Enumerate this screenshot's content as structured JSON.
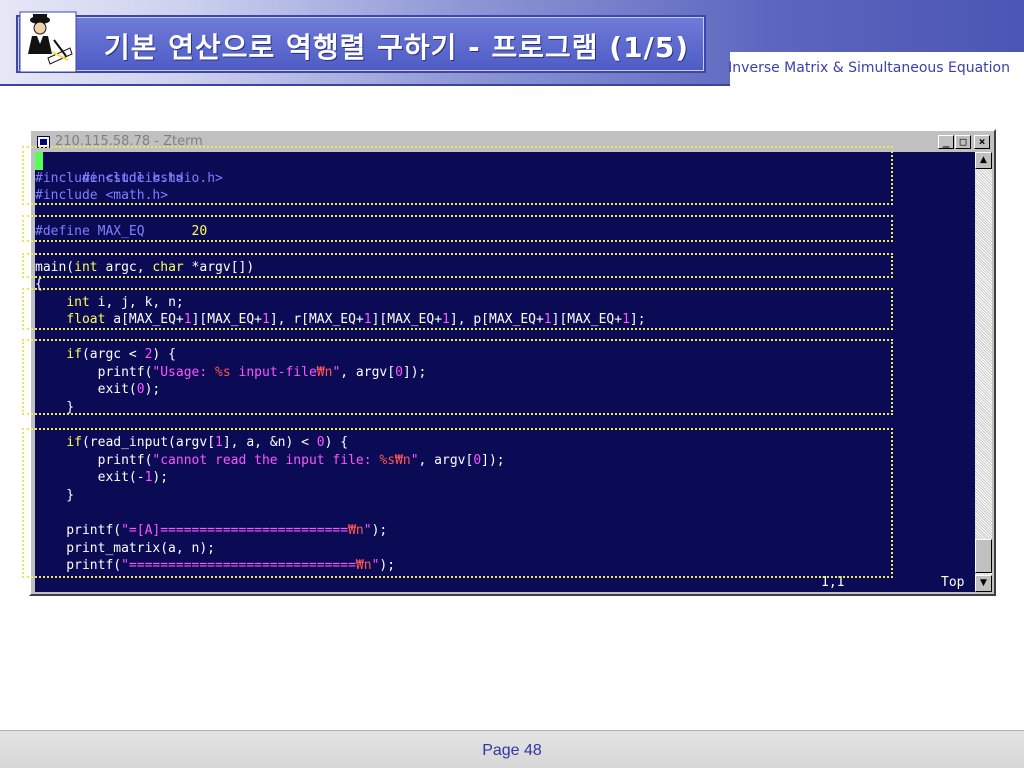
{
  "slide": {
    "title": "기본 연산으로 역행렬 구하기 - 프로그램 (1/5)",
    "subtitle": "Inverse Matrix & Simultaneous Equation",
    "page_label": "Page 48"
  },
  "terminal": {
    "window_title": "210.115.58.78 - Zterm",
    "minimize_label": "_",
    "maximize_label": "□",
    "close_label": "×",
    "scroll_up_label": "▲",
    "scroll_down_label": "▼",
    "status_position": "1,1",
    "status_scroll": "Top",
    "colors": {
      "background": "#0a0a55",
      "preprocessor": "#8080ff",
      "type_keyword": "#ffff55",
      "number_string": "#ff55ff",
      "format_spec": "#ff5555",
      "cursor": "#55ff55",
      "highlight_box": "#e8e85a"
    },
    "code": {
      "l1": "#include <stdio.h>",
      "l2": "#include <stdlib.h>",
      "l3": "#include <math.h>",
      "l5": "#define MAX_EQ      20",
      "l7": "main(int argc, char *argv[])",
      "l8": "{",
      "l9": "    int i, j, k, n;",
      "l10": "    float a[MAX_EQ+1][MAX_EQ+1], r[MAX_EQ+1][MAX_EQ+1], p[MAX_EQ+1][MAX_EQ+1];",
      "l12": "    if(argc < 2) {",
      "l13": "        printf(\"Usage: %s input-file₩n\", argv[0]);",
      "l14": "        exit(0);",
      "l15": "    }",
      "l17": "    if(read_input(argv[1], a, &n) < 0) {",
      "l18": "        printf(\"cannot read the input file: %s₩n\", argv[0]);",
      "l19": "        exit(-1);",
      "l20": "    }",
      "l22": "    printf(\"=[A]========================₩n\");",
      "l23": "    print_matrix(a, n);",
      "l24": "    printf(\"=============================₩n\");"
    }
  }
}
